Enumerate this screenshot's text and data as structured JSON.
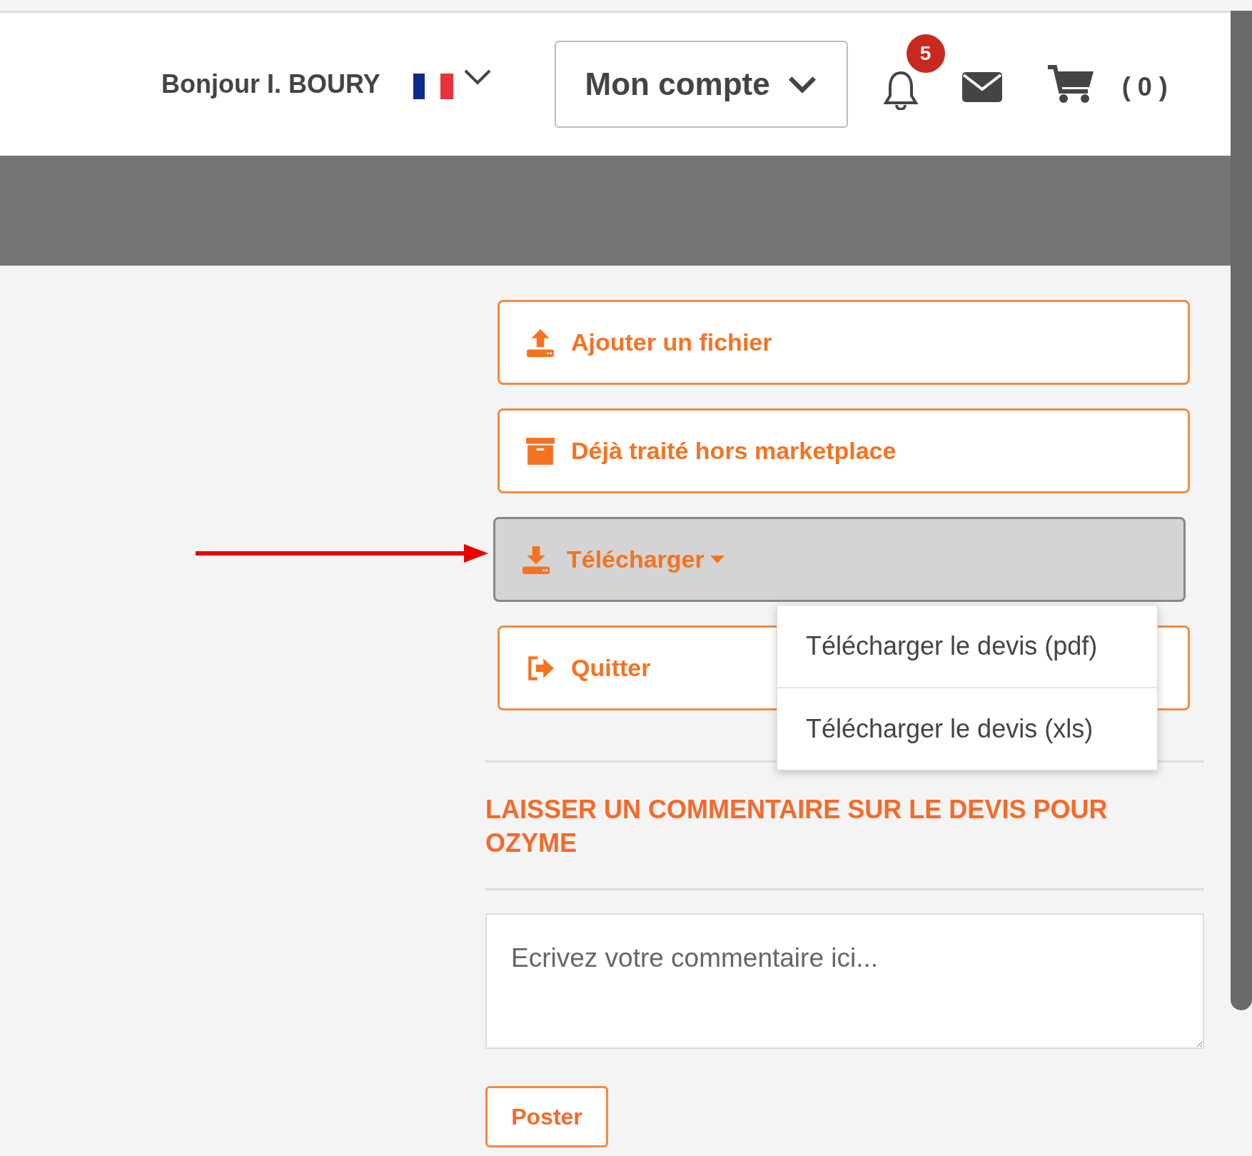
{
  "header": {
    "greeting": "Bonjour I. BOURY",
    "language": {
      "expanded": false
    },
    "account_menu": {
      "label": "Mon compte"
    },
    "notifications": {
      "badge": "5"
    },
    "cart": {
      "count": "( 0 )"
    }
  },
  "actions": [
    {
      "kind": "upload",
      "label": "Ajouter un fichier",
      "expanded": false
    },
    {
      "kind": "archive",
      "label": "Déjà traité hors marketplace",
      "expanded": false
    },
    {
      "kind": "download",
      "label": "Télécharger",
      "expanded": true,
      "menu_items": [
        "Télécharger le devis (pdf)",
        "Télécharger le devis (xls)"
      ],
      "annotated": true
    },
    {
      "kind": "exit",
      "label": "Quitter",
      "expanded": false
    }
  ],
  "comment": {
    "heading": "LAISSER UN COMMENTAIRE SUR LE DEVIS POUR OZYME",
    "placeholder": "Ecrivez votre commentaire ici...",
    "submit": "Poster"
  }
}
